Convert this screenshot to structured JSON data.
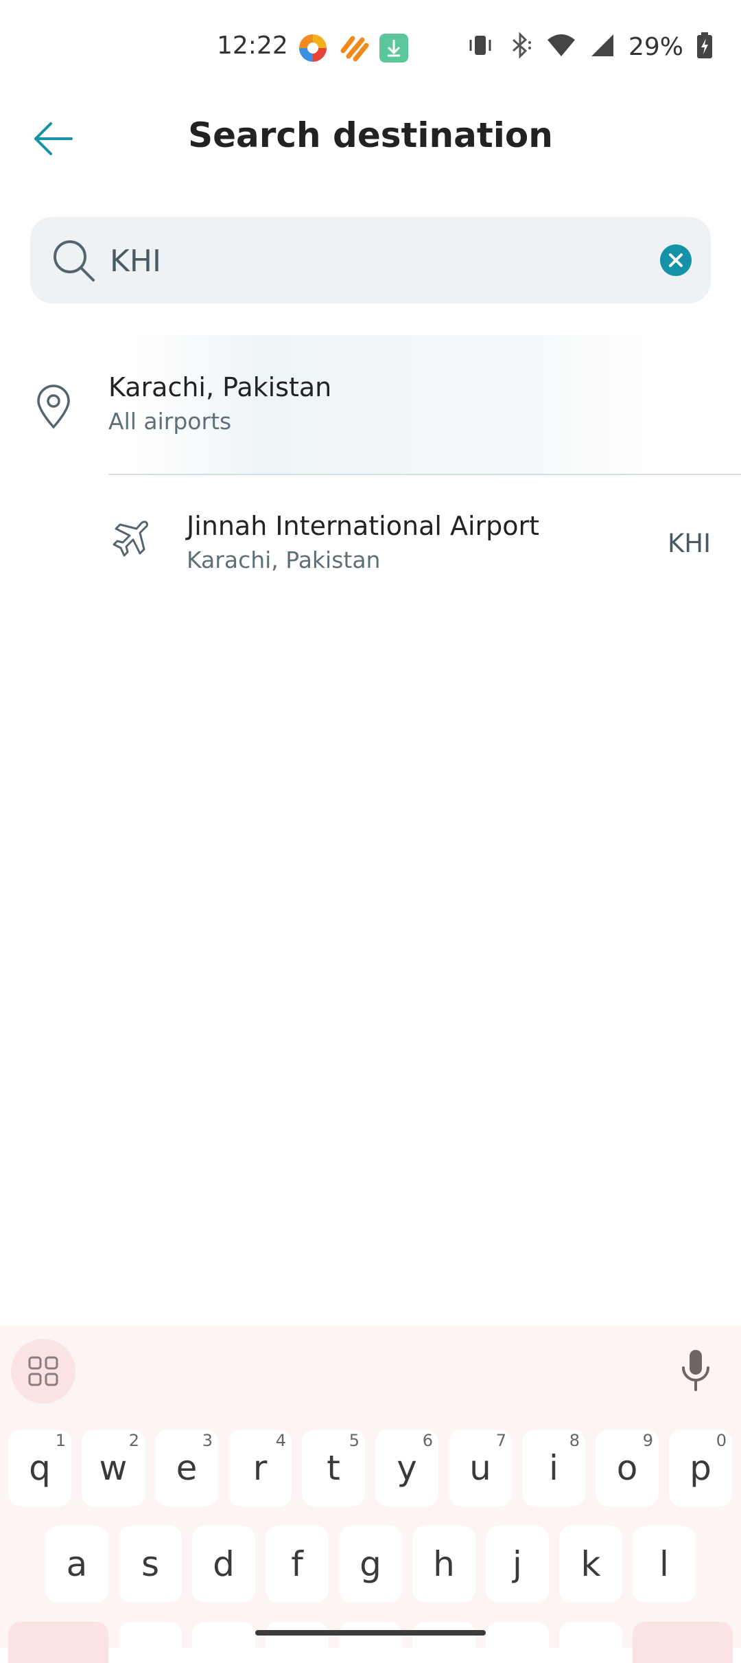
{
  "status_bar": {
    "time": "12:22",
    "battery": "29%",
    "icons": [
      "photos-app-icon",
      "health-app-icon",
      "download-app-icon",
      "vibrate-icon",
      "bluetooth-icon",
      "wifi-icon",
      "signal-icon",
      "battery-charging-icon"
    ]
  },
  "header": {
    "title": "Search destination",
    "back_icon": "arrow-left-icon",
    "accent_color": "#1591a8"
  },
  "search": {
    "value": "KHI",
    "placeholder": "",
    "icon": "search-icon",
    "clear_icon": "clear-icon"
  },
  "results": [
    {
      "type": "city",
      "icon": "location-pin-icon",
      "title": "Karachi, Pakistan",
      "subtitle": "All airports",
      "code": ""
    },
    {
      "type": "airport",
      "icon": "airplane-icon",
      "title": "Jinnah International Airport",
      "subtitle": "Karachi, Pakistan",
      "code": "KHI"
    }
  ],
  "keyboard": {
    "row1": [
      {
        "key": "q",
        "hint": "1"
      },
      {
        "key": "w",
        "hint": "2"
      },
      {
        "key": "e",
        "hint": "3"
      },
      {
        "key": "r",
        "hint": "4"
      },
      {
        "key": "t",
        "hint": "5"
      },
      {
        "key": "y",
        "hint": "6"
      },
      {
        "key": "u",
        "hint": "7"
      },
      {
        "key": "i",
        "hint": "8"
      },
      {
        "key": "o",
        "hint": "9"
      },
      {
        "key": "p",
        "hint": "0"
      }
    ],
    "row2": [
      "a",
      "s",
      "d",
      "f",
      "g",
      "h",
      "j",
      "k",
      "l"
    ]
  }
}
